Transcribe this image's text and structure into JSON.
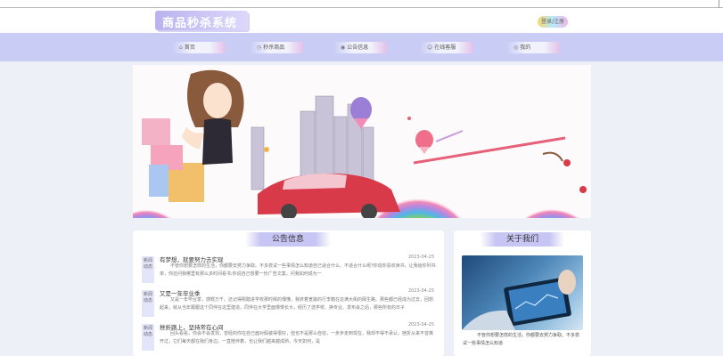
{
  "header": {
    "logo": "商品秒杀系统",
    "login": "登录/注册"
  },
  "nav": [
    {
      "label": "首页",
      "icon": "home-icon",
      "glyph": "⌂"
    },
    {
      "label": "秒杀商品",
      "icon": "clock-icon",
      "glyph": "◷"
    },
    {
      "label": "公告信息",
      "icon": "megaphone-icon",
      "glyph": "◉"
    },
    {
      "label": "在线客服",
      "icon": "support-icon",
      "glyph": "☺"
    },
    {
      "label": "我的",
      "icon": "user-icon",
      "glyph": "◎"
    }
  ],
  "notice": {
    "title": "公告信息",
    "tag": "新闻动态",
    "items": [
      {
        "title": "有梦想，就要努力去实现",
        "date": "2023-04-25",
        "desc": "不管你想要怎样的生活，你都要去努力争取。不多尝试一些事情怎么知道自己适合什么、不适合什么呢?你说你喜欢读书，让我给你列书单，你还问我哪里有那么多时间看书;你说自己想要一份广告文案，问我如何成为一"
      },
      {
        "title": "又是一年毕业季",
        "date": "2023-04-25",
        "desc": "又是一年毕业季，感慨万千。还记得刚踏进学校那时候的懵懂，我挤着宽敞的行李箱在这满大街的陌生路。那些都已经成为过去，回想起来，就从当年跟跟这个同伴在这里建造，同伴在大学里面慢慢长大，经历了选学校、换专业、发布会之后，那些所有的日子"
      },
      {
        "title": "挫折路上，坚持常在心间",
        "date": "2023-04-25",
        "desc": "回头看看，你会不会发现，曾经的你在自己面对假装得很好，但也不是那么自信，一步步走到现在，我却不得不承认，挫折从来不曾离开过，它们每天都在我们身边，一直陪伴着，也让我们越来越成熟，今天如何，是"
      }
    ]
  },
  "about": {
    "title": "关于我们",
    "text": "不管你想要怎样的生活，你都要去努力争取。不多尝试一些事情怎么知道"
  },
  "colors": {
    "nav_bg": "#c9ccf5",
    "accent": "#b9b3ee",
    "page_bg": "#eef0f8"
  }
}
